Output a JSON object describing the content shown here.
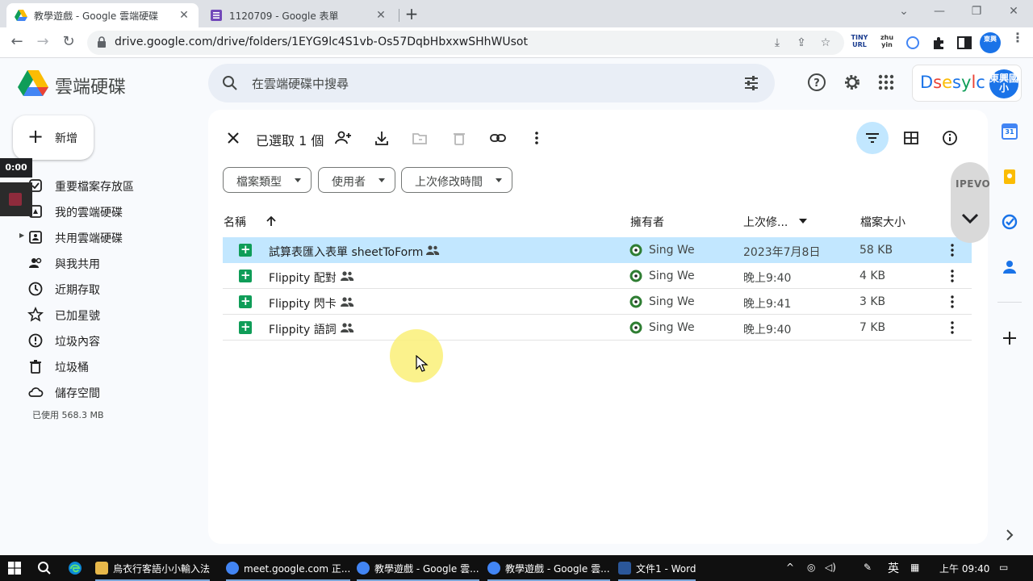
{
  "browser": {
    "tabs": [
      {
        "title": "教學遊戲 - Google 雲端硬碟",
        "active": true
      },
      {
        "title": "1120709 - Google 表單",
        "active": false
      }
    ],
    "url": "drive.google.com/drive/folders/1EYG9lc4S1vb-Os57DqbHbxxwSHhWUsot",
    "extensions": [
      "TINY URL",
      "zhu yin"
    ]
  },
  "drive": {
    "product": "雲端硬碟",
    "search_placeholder": "在雲端硬碟中搜尋",
    "account_brand": "Dsesylc",
    "account_avatar": "東興國小"
  },
  "sidebar": {
    "new_label": "新增",
    "items": [
      {
        "label": "重要檔案存放區",
        "icon": "priority-icon"
      },
      {
        "label": "我的雲端硬碟",
        "icon": "my-drive-icon"
      },
      {
        "label": "共用雲端硬碟",
        "icon": "shared-drives-icon"
      },
      {
        "label": "與我共用",
        "icon": "shared-with-me-icon"
      },
      {
        "label": "近期存取",
        "icon": "recent-icon"
      },
      {
        "label": "已加星號",
        "icon": "star-icon"
      },
      {
        "label": "垃圾內容",
        "icon": "spam-icon"
      },
      {
        "label": "垃圾桶",
        "icon": "trash-icon"
      },
      {
        "label": "儲存空間",
        "icon": "cloud-icon"
      }
    ],
    "storage_used": "已使用 568.3 MB"
  },
  "recording": {
    "timer": "0:00"
  },
  "selection": {
    "count_label": "已選取 1 個"
  },
  "filters": [
    "檔案類型",
    "使用者",
    "上次修改時間"
  ],
  "columns": {
    "name": "名稱",
    "owner": "擁有者",
    "modified": "上次修...",
    "size": "檔案大小"
  },
  "files": [
    {
      "name": "試算表匯入表單 sheetToForm",
      "owner": "Sing We",
      "modified": "2023年7月8日",
      "size": "58 KB",
      "selected": true
    },
    {
      "name": "Flippity 配對",
      "owner": "Sing We",
      "modified": "晚上9:40",
      "size": "4 KB",
      "selected": false
    },
    {
      "name": "Flippity 閃卡",
      "owner": "Sing We",
      "modified": "晚上9:41",
      "size": "3 KB",
      "selected": false
    },
    {
      "name": "Flippity 語詞",
      "owner": "Sing We",
      "modified": "晚上9:40",
      "size": "7 KB",
      "selected": false
    }
  ],
  "side_panel": {
    "calendar_day": "31",
    "ipevo_label": "IPEVO"
  },
  "taskbar": {
    "items": [
      {
        "label": "烏衣行客語小小輸入法",
        "color": "#e8b84a"
      },
      {
        "label": "meet.google.com 正...",
        "color": "#4285f4"
      },
      {
        "label": "教學遊戲 - Google 雲...",
        "color": "#4285f4"
      },
      {
        "label": "教學遊戲 - Google 雲...",
        "color": "#4285f4"
      },
      {
        "label": "文件1 - Word",
        "color": "#2b579a"
      }
    ],
    "ime": "英",
    "clock": "上午 09:40"
  },
  "colors": {
    "accent": "#1a73e8",
    "selected_row": "#c2e7ff",
    "sheets_green": "#0f9d58"
  }
}
